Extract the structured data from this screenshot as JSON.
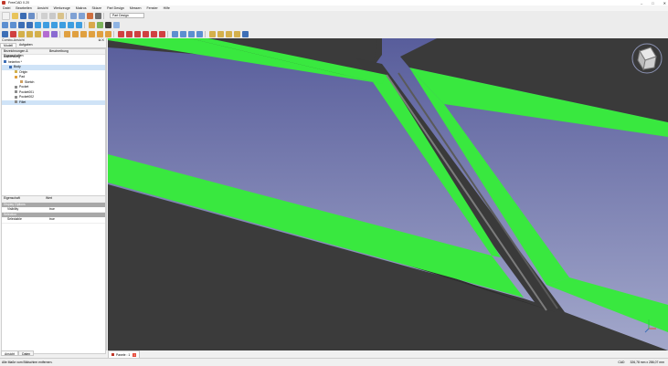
{
  "window": {
    "title": "FreeCAD 0.20",
    "minimize": "–",
    "maximize": "□",
    "close": "✕"
  },
  "menu": [
    "Datei",
    "Bearbeiten",
    "Ansicht",
    "Werkzeuge",
    "Makros",
    "Skizze",
    "Part Design",
    "Messen",
    "Fenster",
    "Hilfe"
  ],
  "workbench": {
    "label": "Part Design"
  },
  "combo_view": {
    "title": "Combo-Ansicht",
    "tabs": [
      "Modell",
      "Aufgaben"
    ],
    "tree_headers": [
      "Bezeichnungen & Eigenschaften",
      "Beschreibung"
    ],
    "section": "Anwendung",
    "tree": [
      {
        "label": "heizelnn *",
        "depth": 0,
        "color": "#3d6fb6",
        "selected": false
      },
      {
        "label": "Body",
        "depth": 1,
        "color": "#3d6fb6",
        "selected": true
      },
      {
        "label": "Origin",
        "depth": 2,
        "color": "#d4b04b",
        "selected": false
      },
      {
        "label": "Pad",
        "depth": 2,
        "color": "#e0a040",
        "selected": false
      },
      {
        "label": "Sketch",
        "depth": 3,
        "color": "#d0a060",
        "selected": false
      },
      {
        "label": "Pocket",
        "depth": 2,
        "color": "#8d8d8d",
        "selected": false
      },
      {
        "label": "Pocket001",
        "depth": 2,
        "color": "#8d8d8d",
        "selected": false
      },
      {
        "label": "Pocket002",
        "depth": 2,
        "color": "#8d8d8d",
        "selected": false
      },
      {
        "label": "Fillet",
        "depth": 2,
        "color": "#8d8d8d",
        "selected": true
      }
    ]
  },
  "properties": {
    "header": {
      "k": "Eigenschaft",
      "v": "Wert"
    },
    "groups": [
      {
        "name": "Display Options",
        "rows": [
          {
            "k": "Visibility",
            "v": "true"
          }
        ]
      },
      {
        "name": "Selection",
        "rows": [
          {
            "k": "Selectable",
            "v": "true"
          }
        ]
      }
    ]
  },
  "bottom_tabs": [
    "Ansicht",
    "Daten"
  ],
  "document_tab": {
    "label": "Panele : 1"
  },
  "status": {
    "message": "Alle Maße vom Bildschirm entfernen.",
    "nav": "CAD",
    "dims": "326,78 mm x 286,07 mm"
  },
  "colors": {
    "face_green": "#39e83f",
    "body_dark": "#3b3b3b",
    "bg_top": "#5a5f9c",
    "bg_bottom": "#9aa0c6"
  }
}
